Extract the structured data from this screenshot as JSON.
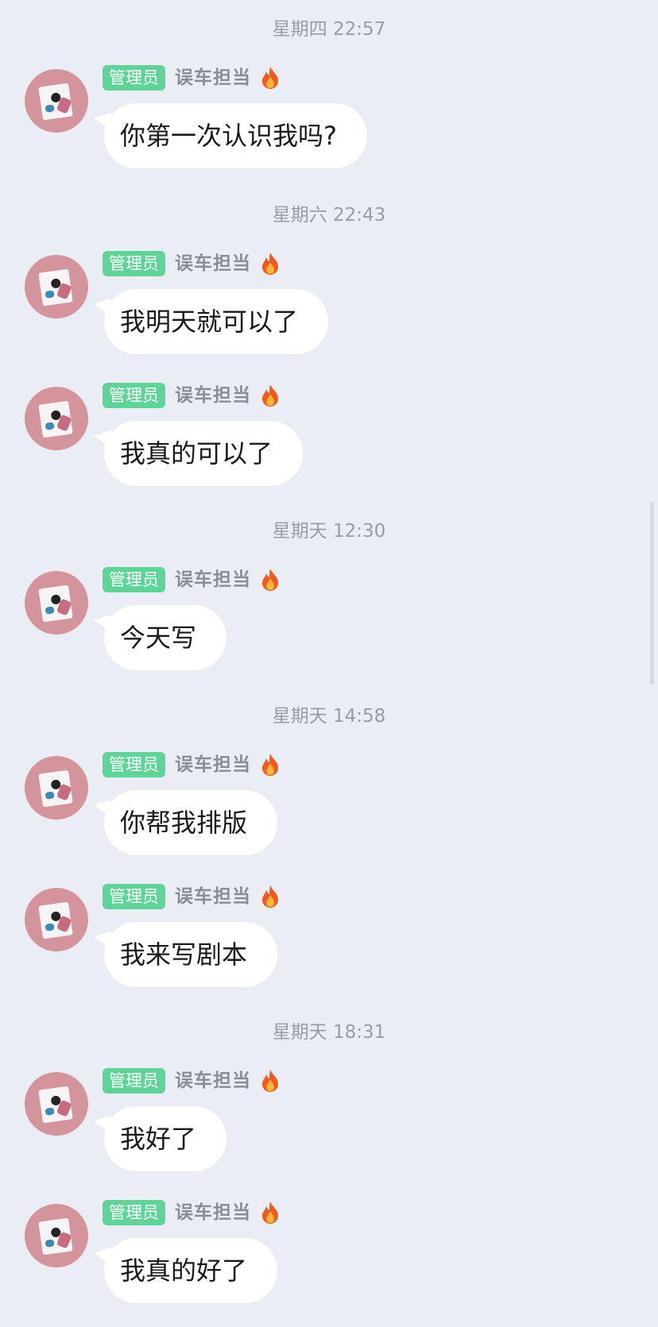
{
  "common": {
    "badge": "管理员",
    "name": "误车担当",
    "badge_color": "#5fd498",
    "background": "#ebedf5",
    "bubble_color": "#ffffff"
  },
  "timestamps": [
    "星期四 22:57",
    "星期六 22:43",
    "星期天 12:30",
    "星期天 14:58",
    "星期天 18:31"
  ],
  "messages": [
    "你第一次认识我吗?",
    "我明天就可以了",
    "我真的可以了",
    "今天写",
    "你帮我排版",
    "我来写剧本",
    "我好了",
    "我真的好了"
  ]
}
